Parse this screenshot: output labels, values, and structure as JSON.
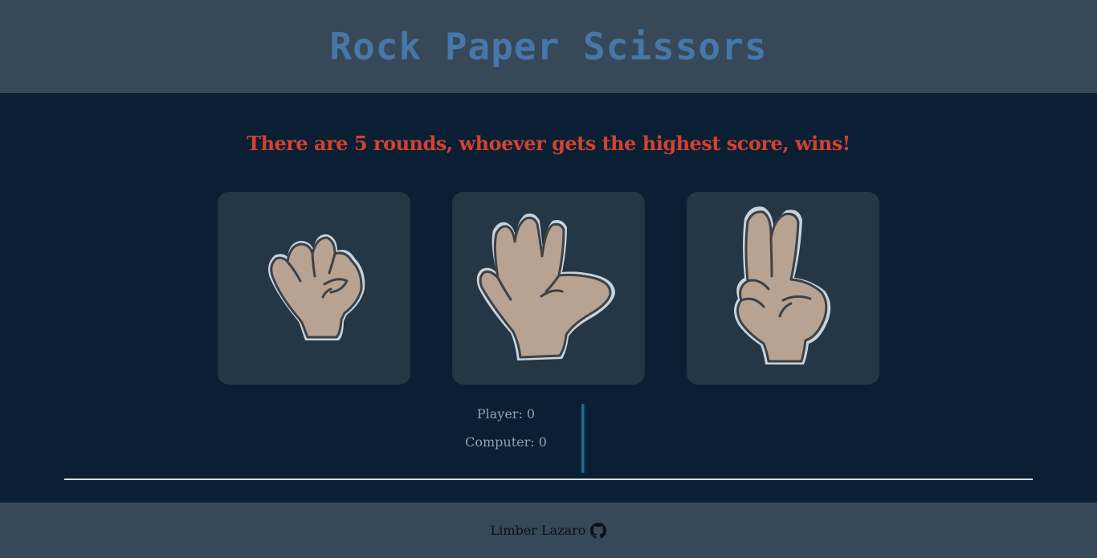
{
  "header": {
    "title": "Rock Paper Scissors"
  },
  "main": {
    "instructions": "There are 5 rounds, whoever gets the highest score, wins!",
    "choices": [
      {
        "name": "rock",
        "icon": "rock-hand-icon"
      },
      {
        "name": "paper",
        "icon": "paper-hand-icon"
      },
      {
        "name": "scissors",
        "icon": "scissors-hand-icon"
      }
    ],
    "scoreboard": {
      "player": "Player: 0",
      "computer": "Computer: 0"
    }
  },
  "footer": {
    "author": "Limber Lazaro",
    "icon": "github-icon"
  },
  "colors": {
    "header_bg": "#374858",
    "page_bg": "#0a1f33",
    "title": "#4677a8",
    "instructions": "#d2432f",
    "card_bg": "#253645",
    "hand_fill": "#b8a393"
  }
}
